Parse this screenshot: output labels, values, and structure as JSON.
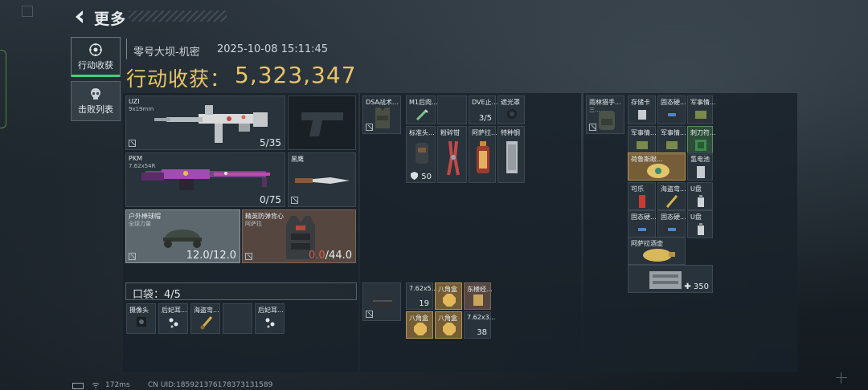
{
  "nav": {
    "back_label": "更多"
  },
  "tabs": [
    {
      "label": "行动收获",
      "icon": "target-icon",
      "active": true
    },
    {
      "label": "击败列表",
      "icon": "skull-icon",
      "active": false
    }
  ],
  "header": {
    "map_name": "零号大坝-机密",
    "datetime": "2025-10-08 15:11:45",
    "haul_label": "行动收获：",
    "haul_value": "5,323,347"
  },
  "equipment": {
    "primary": {
      "name": "UZI",
      "ammo": "9x19mm",
      "count": "5/35"
    },
    "secondary": {
      "name": "PKM",
      "ammo": "7.62x54R",
      "count": "0/75"
    },
    "melee": {
      "name": "黑鹰"
    },
    "helmet": {
      "name": "户外棒球帽",
      "sub": "全球力量",
      "durability": "12.0/12.0"
    },
    "armor": {
      "name": "精英防弹背心",
      "sub": "阿萨拉",
      "durability_current": "0.0",
      "durability_max": "/44.0"
    }
  },
  "pocket": {
    "label": "口袋：4/5",
    "items": [
      "摄像头",
      "后妃耳...",
      "海盗弯...",
      "",
      "后妃耳..."
    ]
  },
  "rig": {
    "name": "DSA战术...",
    "slots": [
      {
        "name": "M1后肉..."
      },
      {
        "name": ""
      },
      {
        "name": "DVE止...",
        "count": "3/5"
      },
      {
        "name": "遮光罩"
      },
      {
        "name": "标准头...",
        "count": "50"
      },
      {
        "name": "粉碎钳"
      },
      {
        "name": "阿萨拉..."
      },
      {
        "name": "特种钢"
      }
    ]
  },
  "case": {
    "slots": [
      {
        "name": "7.62x5...",
        "count": "19"
      },
      {
        "name": "八角盒"
      },
      {
        "name": "东楼经..."
      },
      {
        "name": "八角盒"
      },
      {
        "name": "八角盒"
      },
      {
        "name": "7.62x3...",
        "count": "38"
      }
    ]
  },
  "backpack": {
    "name": "雨林猎手...",
    "sub": "三...",
    "slots": [
      {
        "name": "存储卡"
      },
      {
        "name": "固态硬..."
      },
      {
        "name": "军事情..."
      },
      {
        "name": "军事情..."
      },
      {
        "name": "军事情..."
      },
      {
        "name": "刺刀符..."
      },
      {
        "name": "荷鲁斯眼..."
      },
      {
        "name": "氢电池"
      },
      {
        "name": "可乐"
      },
      {
        "name": "海盗弯..."
      },
      {
        "name": "U盘"
      },
      {
        "name": "固态硬..."
      },
      {
        "name": "固态硬..."
      },
      {
        "name": "U盘"
      },
      {
        "name": "阿萨拉酒壶"
      },
      {
        "name": "",
        "count": "350"
      }
    ]
  },
  "footer": {
    "ping": "172ms",
    "uid": "CN UID:18592137617837313158​9"
  }
}
